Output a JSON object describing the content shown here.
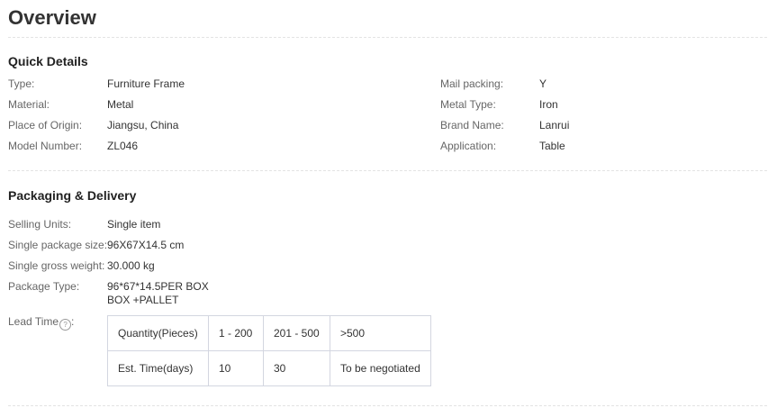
{
  "title": "Overview",
  "quick_details": {
    "heading": "Quick Details",
    "left": [
      {
        "label": "Type:",
        "value": "Furniture Frame"
      },
      {
        "label": "Material:",
        "value": "Metal"
      },
      {
        "label": "Place of Origin:",
        "value": "Jiangsu, China"
      },
      {
        "label": "Model Number:",
        "value": "ZL046"
      }
    ],
    "right": [
      {
        "label": "Mail packing:",
        "value": "Y"
      },
      {
        "label": "Metal Type:",
        "value": "Iron"
      },
      {
        "label": "Brand Name:",
        "value": "Lanrui"
      },
      {
        "label": "Application:",
        "value": "Table"
      }
    ]
  },
  "packaging": {
    "heading": "Packaging & Delivery",
    "rows": [
      {
        "label": "Selling Units:",
        "value": "Single item"
      },
      {
        "label": "Single package size:",
        "value": "96X67X14.5 cm"
      },
      {
        "label": "Single gross weight:",
        "value": "30.000 kg"
      }
    ],
    "package_type": {
      "label": "Package Type:",
      "line1": "96*67*14.5PER BOX",
      "line2": "BOX +PALLET"
    },
    "lead_time": {
      "label": "Lead Time",
      "help_icon": "?",
      "table": [
        [
          "Quantity(Pieces)",
          "1 - 200",
          "201 - 500",
          ">500"
        ],
        [
          "Est. Time(days)",
          "10",
          "30",
          "To be negotiated"
        ]
      ]
    }
  }
}
